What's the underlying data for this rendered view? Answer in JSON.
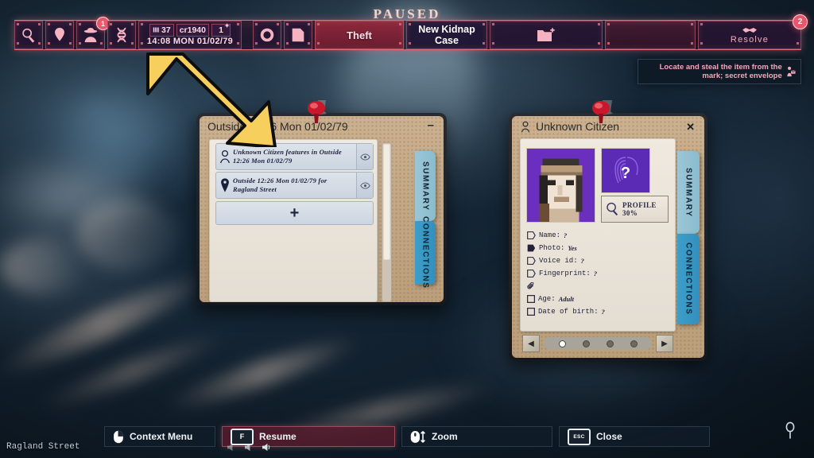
{
  "hud": {
    "paused_label": "PAUSED",
    "icons": [
      {
        "name": "search-icon",
        "badge": null
      },
      {
        "name": "map-pin-icon",
        "badge": null
      },
      {
        "name": "detective-icon",
        "badge": "1"
      },
      {
        "name": "dna-icon",
        "badge": null
      }
    ],
    "stats": {
      "city_count": "37",
      "currency": "cr1940",
      "stars": "1",
      "clock": "14:08 MON 01/02/79"
    },
    "tool_icons": [
      {
        "name": "ring-icon"
      },
      {
        "name": "notes-icon"
      }
    ],
    "case_type": "Theft",
    "new_case": "New Kidnap Case",
    "new_folder_icon": "new-folder-icon",
    "resolve_label": "Resolve",
    "resolve_icon": "handshake-icon",
    "notification_count": "2"
  },
  "objective": {
    "text": "Locate and steal the item from the mark; secret envelope",
    "icon": "envelope-person-icon"
  },
  "left_window": {
    "title": "Outside 12:26 Mon 01/02/79",
    "minimize_label": "–",
    "entries": [
      {
        "icon": "person-icon",
        "text": "Unknown Citizen features in Outside 12:26 Mon 01/02/79",
        "action_icon": "eye-icon"
      },
      {
        "icon": "pin-icon",
        "text": "Outside 12:26 Mon 01/02/79 for Ragland Street",
        "action_icon": "eye-icon"
      }
    ],
    "add_label": "+",
    "tabs": [
      {
        "label": "SUMMARY",
        "active": true
      },
      {
        "label": "CONNECTIONS",
        "active": false
      }
    ]
  },
  "right_window": {
    "title": "Unknown Citizen",
    "title_icon": "person-icon",
    "close_label": "✕",
    "photo_alt": "citizen-portrait",
    "fingerprint_mark": "?",
    "profile": {
      "label": "PROFILE",
      "value": "30%",
      "icon": "magnifier-icon"
    },
    "attributes": [
      {
        "icon": "tag-outline",
        "label": "Name:",
        "value": "?"
      },
      {
        "icon": "tag-filled",
        "label": "Photo:",
        "value": "Yes"
      },
      {
        "icon": "tag-outline",
        "label": "Voice id:",
        "value": "?"
      },
      {
        "icon": "tag-outline",
        "label": "Fingerprint:",
        "value": "?"
      },
      {
        "icon": "paperclip",
        "label": "",
        "value": ""
      },
      {
        "icon": "checkbox",
        "label": "Age:",
        "value": "Adult"
      },
      {
        "icon": "checkbox",
        "label": "Date of birth:",
        "value": "?"
      }
    ],
    "pager": {
      "prev": "◀",
      "next": "▶",
      "pages": 4,
      "active": 0
    },
    "tabs": [
      {
        "label": "SUMMARY",
        "active": true
      },
      {
        "label": "CONNECTIONS",
        "active": false
      }
    ]
  },
  "bottom_bar": {
    "hints": [
      {
        "key": "",
        "icon": "mouse-right-icon",
        "label": "Context Menu"
      },
      {
        "key": "F",
        "icon": "",
        "label": "Resume"
      },
      {
        "key": "",
        "icon": "mouse-scroll-icon",
        "label": "Zoom"
      },
      {
        "key": "ESC",
        "icon": "",
        "label": "Close"
      }
    ]
  },
  "status": {
    "street": "Ragland Street",
    "footstep_icon": "footprint-icon"
  },
  "colors": {
    "hud_pink": "#f5b3c2",
    "hud_border": "#e0697a",
    "tab_active": "#9cc6d6",
    "tab_inactive": "#338fbd",
    "arrow_yellow": "#f7cf5d",
    "photo_purple": "#6a2fbf"
  }
}
